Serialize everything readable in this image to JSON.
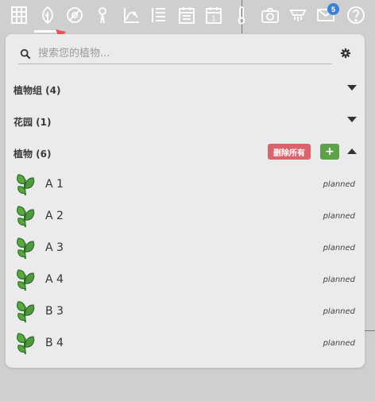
{
  "toolbar": {
    "icons": [
      "grid-icon",
      "leaf-icon",
      "no-sign-icon",
      "pin-icon",
      "chart-icon",
      "list-icon",
      "calendar-icon",
      "calendar-day-icon",
      "thermometer-icon",
      "camera-icon",
      "sensor-icon",
      "mail-icon",
      "help-icon"
    ],
    "calendar_day": "1",
    "notifications_count": "5"
  },
  "search": {
    "placeholder": "搜索您的植物..."
  },
  "sections": {
    "groups": {
      "label": "植物组 (4)"
    },
    "gardens": {
      "label": "花园 (1)"
    },
    "plants": {
      "label": "植物 (6)",
      "delete_all_label": "删除所有",
      "add_label": "+"
    }
  },
  "plants": [
    {
      "name": "A 1",
      "status": "planned"
    },
    {
      "name": "A 2",
      "status": "planned"
    },
    {
      "name": "A 3",
      "status": "planned"
    },
    {
      "name": "A 4",
      "status": "planned"
    },
    {
      "name": "B 3",
      "status": "planned"
    },
    {
      "name": "B 4",
      "status": "planned"
    }
  ],
  "colors": {
    "accent": "#3d7fd6",
    "delete": "#d9646b",
    "add": "#5fa04a",
    "plant_green": "#4f9a3d"
  }
}
